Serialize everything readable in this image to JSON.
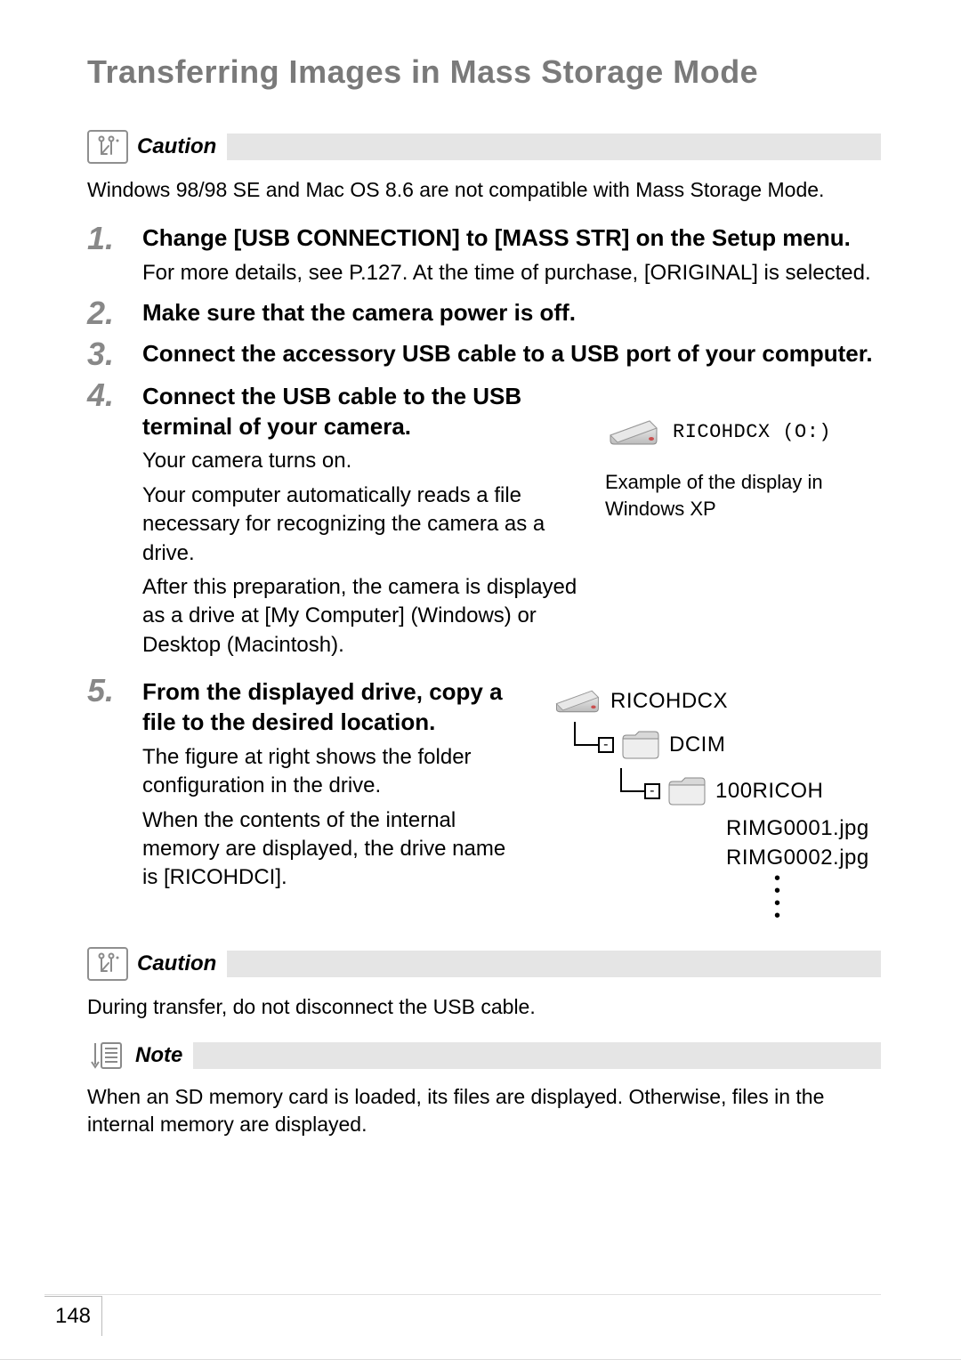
{
  "page": {
    "title": "Transferring Images in Mass Storage Mode",
    "number": "148"
  },
  "caution1": {
    "label": "Caution",
    "text": "Windows 98/98 SE and Mac OS 8.6 are not compatible with Mass Storage Mode."
  },
  "steps": [
    {
      "head": "Change [USB CONNECTION] to [MASS STR] on the Setup menu.",
      "body": "For more details, see P.127. At the time of purchase, [ORIGINAL] is selected."
    },
    {
      "head": "Make sure that the camera power is off."
    },
    {
      "head": "Connect the accessory USB cable to a USB port of your computer."
    },
    {
      "head": "Connect the USB cable to the USB terminal of your camera.",
      "body1": "Your camera turns on.",
      "body2": "Your computer automatically reads a file necessary for recognizing the camera as a drive.",
      "body3": "After this preparation, the camera is displayed as a drive at [My Computer] (Windows) or Desktop (Macintosh).",
      "driveLabel": "RICOHDCX (O:)",
      "caption": "Example of the display in Windows XP"
    },
    {
      "head": "From the displayed drive, copy a file to the desired location.",
      "body1": "The figure at right shows the folder configuration in the drive.",
      "body2": "When the contents of the internal memory are displayed, the drive name is [RICOHDCI].",
      "tree": {
        "root": "RICOHDCX",
        "l1": "DCIM",
        "l2": "100RICOH",
        "files": [
          "RIMG0001.jpg",
          "RIMG0002.jpg"
        ]
      }
    }
  ],
  "caution2": {
    "label": "Caution",
    "text": "During transfer, do not disconnect the USB cable."
  },
  "note": {
    "label": "Note",
    "text": "When an SD memory card is loaded, its files are displayed. Otherwise, files in the internal memory are displayed."
  }
}
